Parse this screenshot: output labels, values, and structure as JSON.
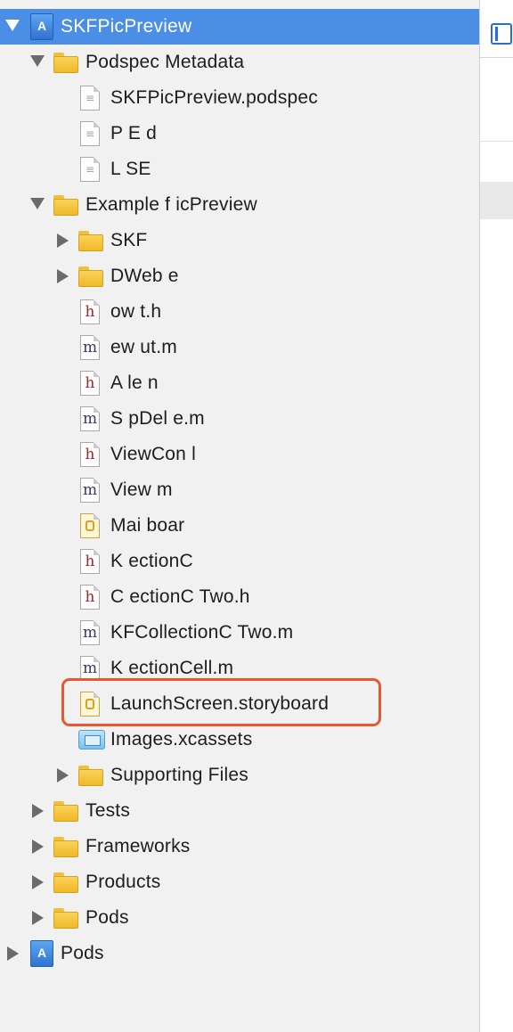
{
  "tree": {
    "root_project": {
      "label": "SKFPicPreview",
      "icon": "project-icon"
    },
    "groups": {
      "podspec_metadata": "Podspec Metadata",
      "example": "Example f      icPreview",
      "supporting_files": "Supporting Files"
    },
    "files": {
      "podspec": "SKFPicPreview.podspec",
      "readme": "P          E    d",
      "license": "L     SE",
      "skf_folder": "SKF           ",
      "sdwebimage": "    DWeb     e",
      "layout_h": "         ow     t.h",
      "layout_m": "          ew         ut.m",
      "appdelegate_h": "      A    le       n",
      "appdelegate_m": "S       pDel     e.m",
      "viewcontroller_h": "ViewCon      l",
      "viewcontroller_m": "View           m",
      "main_storyboard": "Mai       boar",
      "cell_h": "K        ectionC",
      "celltwo_h": "   C    ectionC    Two.h",
      "celltwo_m": "KFCollectionC     Two.m",
      "cell_m": "K       ectionCell.m",
      "launchscreen": "LaunchScreen.storyboard",
      "images": "Images.xcassets"
    },
    "top_level": {
      "tests": "Tests",
      "frameworks": "Frameworks",
      "products": "Products",
      "pods_group": "Pods",
      "pods_project": "Pods"
    },
    "icon_glyphs": {
      "header": "h",
      "source": "m",
      "project": "A",
      "plain": "≡"
    }
  },
  "colors": {
    "selection": "#4a8ee6",
    "highlight_border": "#e8572f",
    "folder": "#f5c842",
    "header_glyph": "#a8262a",
    "source_glyph": "#40336e"
  }
}
